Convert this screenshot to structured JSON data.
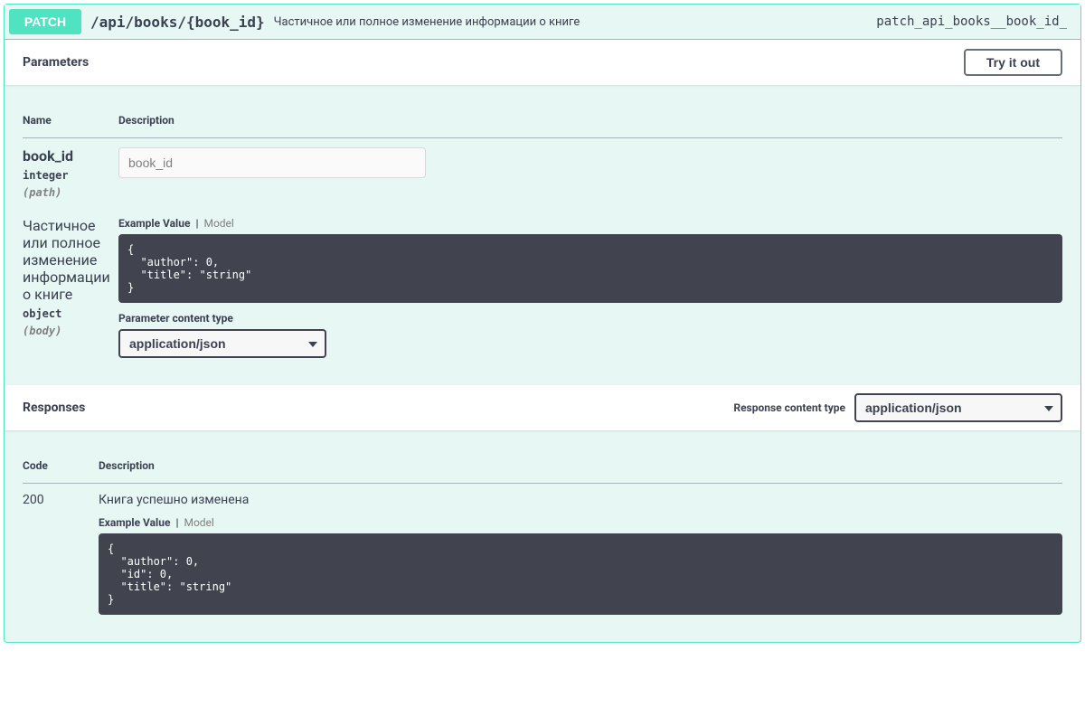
{
  "summary": {
    "method": "PATCH",
    "path": "/api/books/{book_id}",
    "description": "Частичное или полное изменение информации о книге",
    "operation_id": "patch_api_books__book_id_"
  },
  "parameters": {
    "heading": "Parameters",
    "try_label": "Try it out",
    "columns": {
      "name": "Name",
      "description": "Description"
    },
    "rows": [
      {
        "name": "book_id",
        "type": "integer",
        "in": "(path)",
        "input_placeholder": "book_id"
      },
      {
        "name_long": "Частичное или полное изменение информации о книге",
        "type": "object",
        "in": "(body)",
        "tabs": {
          "example": "Example Value",
          "model": "Model"
        },
        "example": "{\n  \"author\": 0,\n  \"title\": \"string\"\n}",
        "content_type_label": "Parameter content type",
        "content_type": "application/json"
      }
    ]
  },
  "responses": {
    "heading": "Responses",
    "content_type_label": "Response content type",
    "content_type": "application/json",
    "columns": {
      "code": "Code",
      "description": "Description"
    },
    "rows": [
      {
        "code": "200",
        "description": "Книга успешно изменена",
        "tabs": {
          "example": "Example Value",
          "model": "Model"
        },
        "example": "{\n  \"author\": 0,\n  \"id\": 0,\n  \"title\": \"string\"\n}"
      }
    ]
  }
}
